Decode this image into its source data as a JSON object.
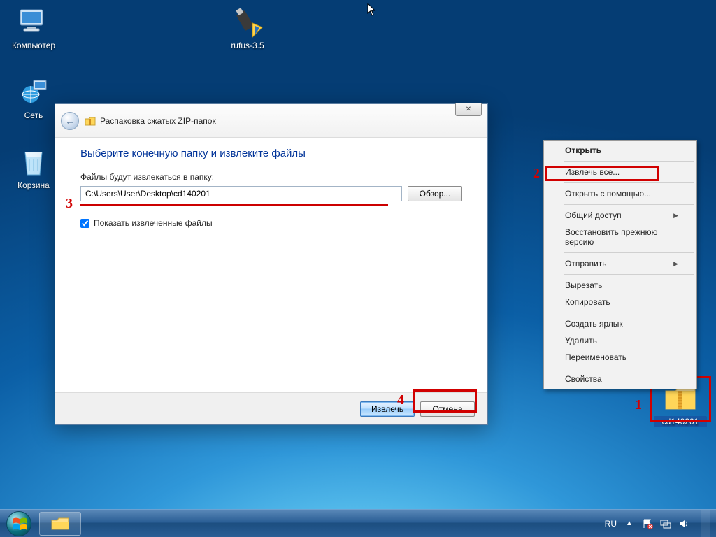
{
  "desktop": {
    "computer_label": "Компьютер",
    "network_label": "Сеть",
    "recycle_label": "Корзина",
    "rufus_label": "rufus-3.5",
    "zip_label": "cd140201"
  },
  "wizard": {
    "title": "Распаковка сжатых ZIP-папок",
    "close": "✕",
    "heading": "Выберите конечную папку и извлеките файлы",
    "dest_label": "Файлы будут извлекаться в папку:",
    "path_value": "C:\\Users\\User\\Desktop\\cd140201",
    "browse": "Обзор...",
    "show_files": "Показать извлеченные файлы",
    "show_files_checked": true,
    "extract": "Извлечь",
    "cancel": "Отмена"
  },
  "context_menu": {
    "open": "Открыть",
    "extract_all": "Извлечь все...",
    "open_with": "Открыть с помощью...",
    "share": "Общий доступ",
    "restore": "Восстановить прежнюю версию",
    "send_to": "Отправить",
    "cut": "Вырезать",
    "copy": "Копировать",
    "shortcut": "Создать ярлык",
    "delete": "Удалить",
    "rename": "Переименовать",
    "properties": "Свойства"
  },
  "annotations": {
    "n1": "1",
    "n2": "2",
    "n3": "3",
    "n4": "4"
  },
  "taskbar": {
    "lang": "RU",
    "time": "",
    "tooltip_flag": "",
    "tooltip_vol": ""
  }
}
